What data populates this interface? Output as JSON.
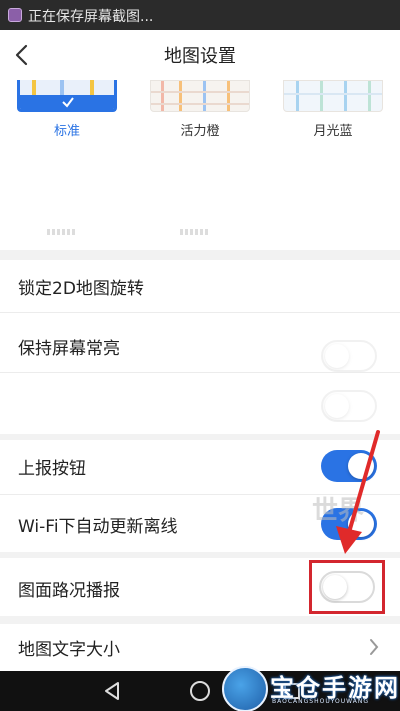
{
  "status_bar": {
    "text": "正在保存屏幕截图..."
  },
  "header": {
    "title": "地图设置",
    "back_icon": "chevron-left-icon"
  },
  "map_styles": [
    {
      "label": "标准",
      "selected": true
    },
    {
      "label": "活力橙",
      "selected": false
    },
    {
      "label": "月光蓝",
      "selected": false
    }
  ],
  "settings": [
    {
      "label": "锁定2D地图旋转"
    },
    {
      "label": "保持屏幕常亮"
    },
    {
      "label": "上报按钮",
      "toggle": "on"
    },
    {
      "label": "Wi-Fi下自动更新离线",
      "toggle": "on"
    },
    {
      "label": "图面路况播报",
      "toggle": "off"
    },
    {
      "label": "地图文字大小",
      "icon": "chevron-right-icon"
    }
  ],
  "nav": {
    "back": "back-triangle-icon",
    "home": "home-circle-icon",
    "recent": "recent-square-icon"
  },
  "watermark": {
    "text": "宝仓手游网",
    "sub": "BAOCANGSHOUYOUWANG",
    "mid": "世界"
  },
  "colors": {
    "accent": "#2a73e4",
    "highlight": "#d3262e",
    "arrow": "#e02a2a"
  }
}
